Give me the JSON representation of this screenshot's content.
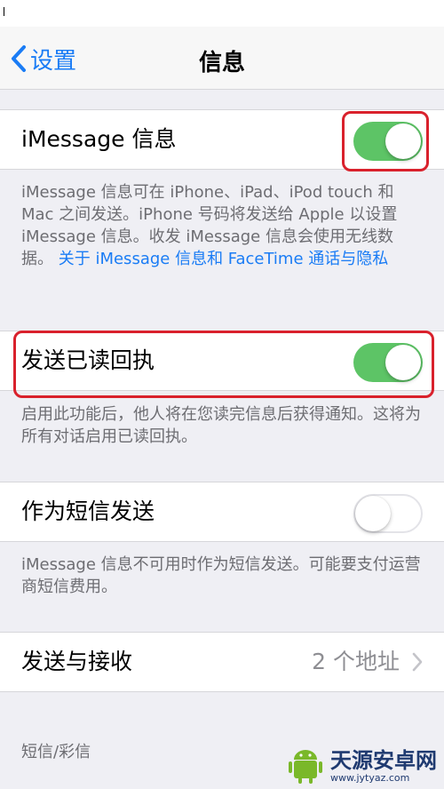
{
  "navbar": {
    "back_label": "设置",
    "title": "信息"
  },
  "imessage": {
    "label": "iMessage 信息",
    "enabled": true,
    "footnote": "iMessage 信息可在 iPhone、iPad、iPod touch 和 Mac 之间发送。iPhone 号码将发送给 Apple 以设置 iMessage 信息。收发 iMessage 信息会使用无线数据。",
    "footnote_link": "关于 iMessage 信息和 FaceTime 通话与隐私"
  },
  "read_receipts": {
    "label": "发送已读回执",
    "enabled": true,
    "footnote": "启用此功能后，他人将在您读完信息后获得通知。这将为所有对话启用已读回执。"
  },
  "send_as_sms": {
    "label": "作为短信发送",
    "enabled": false,
    "footnote": "iMessage 信息不可用时作为短信发送。可能要支付运营商短信费用。"
  },
  "send_receive": {
    "label": "发送与接收",
    "detail": "2 个地址"
  },
  "sms_mms_section": {
    "header": "短信/彩信"
  },
  "watermark": {
    "name": "天源安卓网",
    "url": "www.jytyaz.com"
  },
  "colors": {
    "accent": "#1a7cf5",
    "switch_on": "#5dc466",
    "highlight": "#d9212c",
    "background": "#efeff4"
  },
  "icons": {
    "back": "chevron-left-icon",
    "disclosure": "chevron-right-icon",
    "watermark_logo": "android-logo-icon"
  }
}
